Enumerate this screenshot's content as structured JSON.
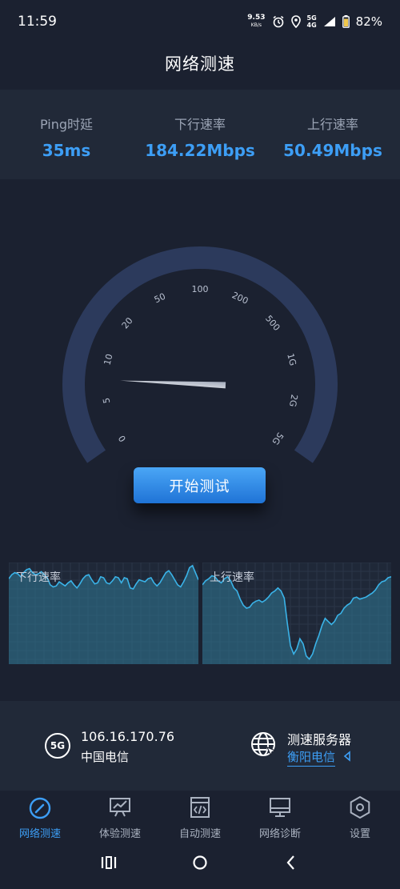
{
  "status_bar": {
    "time": "11:59",
    "net_speed": "9.53",
    "net_unit": "KB/s",
    "signal_line1": "5G",
    "signal_line2": "4G",
    "battery": "82%"
  },
  "title": "网络测速",
  "metrics": [
    {
      "label": "Ping时延",
      "value": "35ms"
    },
    {
      "label": "下行速率",
      "value": "184.22Mbps"
    },
    {
      "label": "上行速率",
      "value": "50.49Mbps"
    }
  ],
  "gauge": {
    "ticks": [
      "0",
      "5",
      "10",
      "20",
      "50",
      "100",
      "200",
      "500",
      "1G",
      "2G",
      "5G"
    ],
    "needle_tick_position": 1.5
  },
  "start_button": "开始测试",
  "charts": {
    "download": {
      "label": "下行速率",
      "values": [
        0.84,
        0.88,
        0.9,
        0.89,
        0.86,
        0.9,
        0.93,
        0.94,
        0.9,
        0.88,
        0.89,
        0.91,
        0.88,
        0.85,
        0.78,
        0.76,
        0.77,
        0.81,
        0.79,
        0.77,
        0.8,
        0.82,
        0.78,
        0.75,
        0.79,
        0.84,
        0.87,
        0.88,
        0.83,
        0.79,
        0.8,
        0.86,
        0.85,
        0.8,
        0.79,
        0.82,
        0.86,
        0.85,
        0.8,
        0.85,
        0.84,
        0.75,
        0.74,
        0.79,
        0.83,
        0.82,
        0.81,
        0.84,
        0.85,
        0.8,
        0.77,
        0.8,
        0.85,
        0.9,
        0.92,
        0.88,
        0.83,
        0.78,
        0.76,
        0.81,
        0.87,
        0.95,
        0.97,
        0.9,
        0.83
      ]
    },
    "upload": {
      "label": "上行速率",
      "values": [
        0.78,
        0.82,
        0.84,
        0.87,
        0.86,
        0.82,
        0.8,
        0.84,
        0.86,
        0.82,
        0.75,
        0.72,
        0.64,
        0.58,
        0.55,
        0.56,
        0.6,
        0.62,
        0.63,
        0.61,
        0.63,
        0.66,
        0.7,
        0.72,
        0.75,
        0.72,
        0.65,
        0.4,
        0.18,
        0.1,
        0.15,
        0.25,
        0.2,
        0.08,
        0.05,
        0.1,
        0.2,
        0.28,
        0.38,
        0.45,
        0.42,
        0.39,
        0.42,
        0.48,
        0.5,
        0.55,
        0.58,
        0.6,
        0.65,
        0.66,
        0.64,
        0.65,
        0.66,
        0.68,
        0.7,
        0.73,
        0.78,
        0.81,
        0.82,
        0.85,
        0.86
      ]
    }
  },
  "connection": {
    "network_type": "5G",
    "ip": "106.16.170.76",
    "carrier": "中国电信"
  },
  "server": {
    "title": "测速服务器",
    "name": "衡阳电信"
  },
  "nav": [
    {
      "label": "网络测速",
      "icon": "speedometer-icon",
      "active": true
    },
    {
      "label": "体验测速",
      "icon": "trend-chart-icon",
      "active": false
    },
    {
      "label": "自动测速",
      "icon": "code-file-icon",
      "active": false
    },
    {
      "label": "网络诊断",
      "icon": "monitor-icon",
      "active": false
    },
    {
      "label": "设置",
      "icon": "hexagon-settings-icon",
      "active": false
    }
  ],
  "colors": {
    "accent": "#3d9ef5",
    "background": "#1b2130",
    "panel": "#212938",
    "gauge_track": "#2c3a5c",
    "chart_line": "#3ab3e8"
  }
}
